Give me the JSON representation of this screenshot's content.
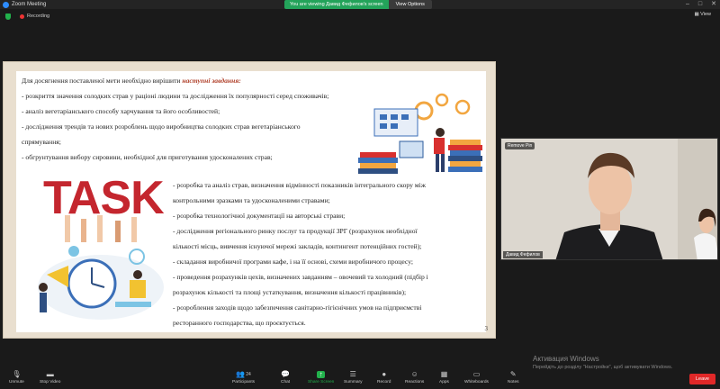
{
  "window": {
    "title": "Zoom Meeting"
  },
  "share_banner": {
    "text": "You are viewing Давид Фефилов's screen",
    "options": "View Options"
  },
  "topbar": {
    "recording": "Recording",
    "view": "View"
  },
  "slide": {
    "intro_plain": "Для досягнення поставленої мети необхідно вирішити ",
    "intro_accent": "наступні завдання:",
    "tasks": [
      "- розкриття значення солодких страв у раціоні людини та дослідження їх популярності серед споживачів;",
      "- аналіз вегетаріанського способу харчування та його особливостей;",
      "- дослідження трендів та нових розроблень щодо виробництва солодких страв вегетаріанського",
      "спрямування;",
      "- обгрунтування вибору сировини, необхідної для приготування удосконалених страв;"
    ],
    "lower_tasks": [
      "- розробка та аналіз страв, визначення відмінності показників інтегрального скору між",
      "контрольними зразками та удосконаленими стравами;",
      "- розробка технологічної документації на авторські страви;",
      "- дослідження регіонального ринку послуг та продукції ЗРГ (розрахунок необхідної",
      "кількості місць, вивчення існуючої мережі закладів, контингент потенційних гостей);",
      "- складання виробничої програми кафе, і на її основі, схеми виробничого процесу;",
      "- проведення розрахунків цехів, визначених завданням – овочевий та холодний (підбір і",
      "розрахунок кількості та площі устаткування, визначення кількості працівників);",
      "- розроблення заходів щодо забезпечення санітарно-гігієнічних умов на підприємстві",
      "ресторанного господарства, що проєктується."
    ],
    "task_word": "TASK",
    "page_number": "3"
  },
  "video": {
    "label_top": "Remove Pin",
    "label_bottom": "Давид Фефилов"
  },
  "watermark": {
    "line1": "Активация Windows",
    "line2": "Перейдіть до розділу \"Настройки\", щоб активувати Windows."
  },
  "toolbar": {
    "items": [
      {
        "label": "Unmute",
        "icon": "microphone-icon",
        "glyph": "🎙"
      },
      {
        "label": "Stop Video",
        "icon": "camera-icon",
        "glyph": "▬"
      },
      {
        "label": "Participants",
        "icon": "participants-icon",
        "glyph": "👥",
        "count": "24"
      },
      {
        "label": "Chat",
        "icon": "chat-icon",
        "glyph": "💬"
      },
      {
        "label": "Share Screen",
        "icon": "share-screen-icon",
        "glyph": "↑"
      },
      {
        "label": "Summary",
        "icon": "summary-icon",
        "glyph": "☰"
      },
      {
        "label": "Record",
        "icon": "record-icon",
        "glyph": "●"
      },
      {
        "label": "Reactions",
        "icon": "reactions-icon",
        "glyph": "☺"
      },
      {
        "label": "Apps",
        "icon": "apps-icon",
        "glyph": "▦"
      },
      {
        "label": "Whiteboards",
        "icon": "whiteboard-icon",
        "glyph": "▭"
      },
      {
        "label": "Notes",
        "icon": "notes-icon",
        "glyph": "✎"
      }
    ],
    "leave": "Leave"
  },
  "colors": {
    "share_green": "#22b14c",
    "leave_red": "#e02828",
    "task_red": "#c4262e"
  }
}
